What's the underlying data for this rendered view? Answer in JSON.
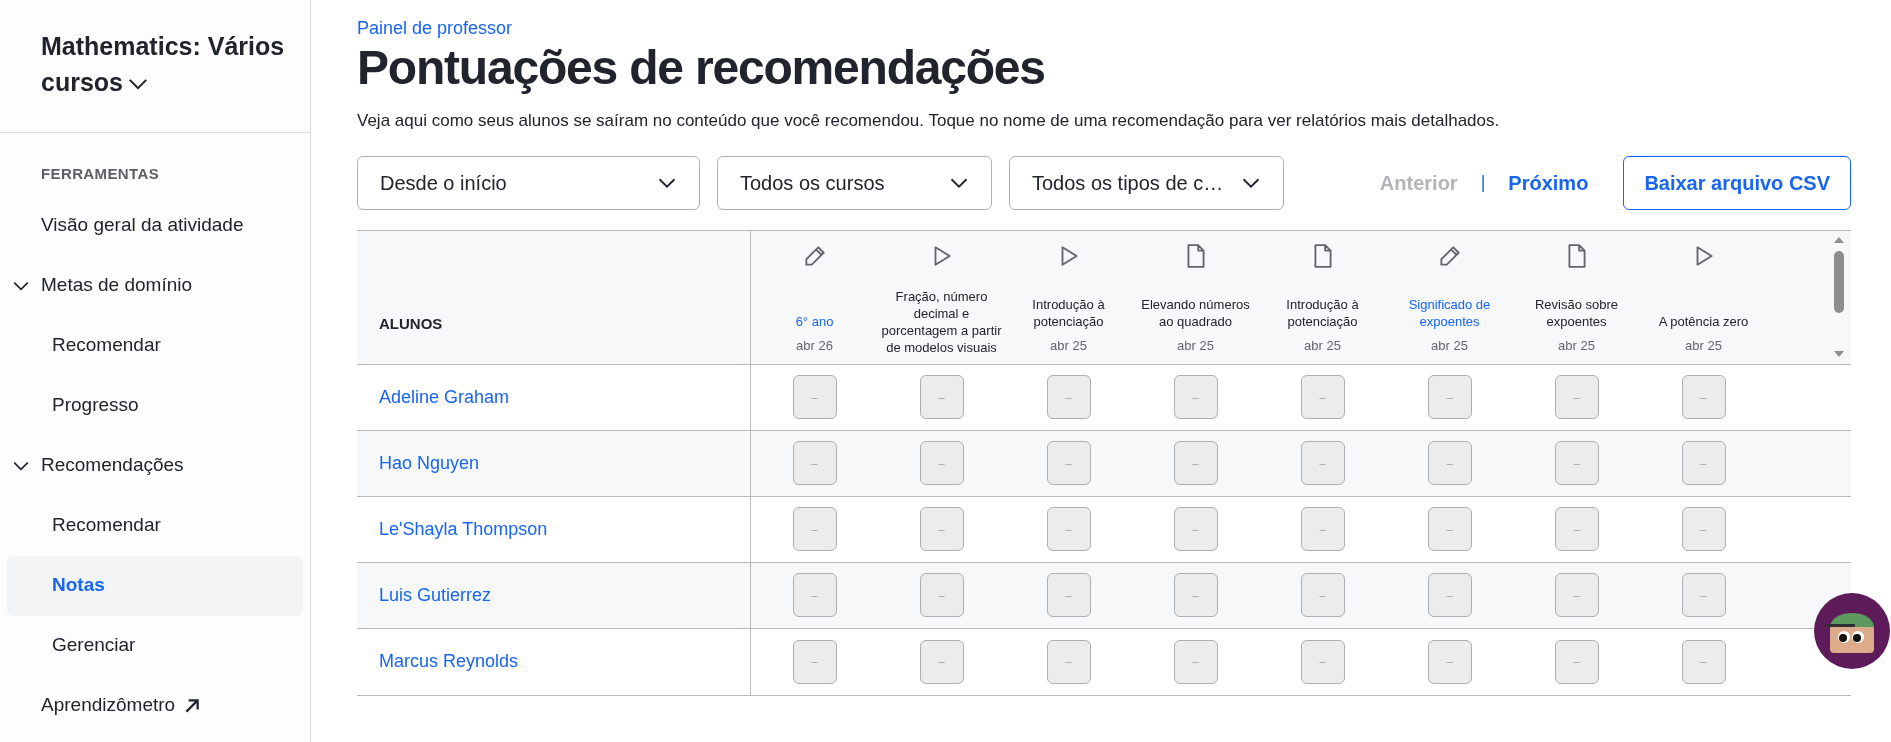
{
  "sidebar": {
    "course_title": "Mathematics: Vários cursos",
    "section_label": "FERRAMENTAS",
    "items": [
      {
        "label": "Visão geral da atividade",
        "selected": false,
        "external": false
      },
      {
        "label": "Metas de domínio",
        "selected": false,
        "external": false,
        "expanded": true,
        "children": [
          {
            "label": "Recomendar",
            "selected": false
          },
          {
            "label": "Progresso",
            "selected": false
          }
        ]
      },
      {
        "label": "Recomendações",
        "selected": false,
        "external": false,
        "expanded": true,
        "children": [
          {
            "label": "Recomendar",
            "selected": false
          },
          {
            "label": "Notas",
            "selected": true
          },
          {
            "label": "Gerenciar",
            "selected": false
          }
        ]
      },
      {
        "label": "Aprendizômetro",
        "selected": false,
        "external": true
      }
    ]
  },
  "header": {
    "breadcrumb": "Painel de professor",
    "title": "Pontuações de recomendações",
    "description": "Veja aqui como seus alunos se saíram no conteúdo que você recomendou. Toque no nome de uma recomendação para ver relatórios mais detalhados."
  },
  "filters": [
    {
      "value": "Desde o início"
    },
    {
      "value": "Todos os cursos"
    },
    {
      "value": "Todos os tipos de c…"
    }
  ],
  "pagination": {
    "previous": {
      "label": "Anterior",
      "disabled": true
    },
    "separator": "|",
    "next": {
      "label": "Próximo",
      "disabled": false
    }
  },
  "download_button": "Baixar arquivo CSV",
  "table": {
    "student_header": "ALUNOS",
    "columns": [
      {
        "kind": "exercise",
        "title": "6° ano",
        "date": "abr 26",
        "linked": true
      },
      {
        "kind": "video",
        "title": "Fração, número decimal e porcentagem a partir de modelos visuais",
        "linked": false
      },
      {
        "kind": "video",
        "title": "Introdução à potenciação",
        "date": "abr 25",
        "linked": false
      },
      {
        "kind": "article",
        "title": "Elevando números ao quadrado",
        "date": "abr 25",
        "linked": false
      },
      {
        "kind": "article",
        "title": "Introdução à potenciação",
        "date": "abr 25",
        "linked": false
      },
      {
        "kind": "exercise",
        "title": "Significado de expoentes",
        "date": "abr 25",
        "linked": true
      },
      {
        "kind": "article",
        "title": "Revisão sobre expoentes",
        "date": "abr 25",
        "linked": false
      },
      {
        "kind": "video",
        "title": "A potência zero",
        "date": "abr 25",
        "linked": false
      }
    ],
    "rows": [
      {
        "student": "Adeline Graham",
        "scores": [
          "–",
          "–",
          "–",
          "–",
          "–",
          "–",
          "–",
          "–"
        ]
      },
      {
        "student": "Hao Nguyen",
        "scores": [
          "–",
          "–",
          "–",
          "–",
          "–",
          "–",
          "–",
          "–"
        ]
      },
      {
        "student": "Le'Shayla Thompson",
        "scores": [
          "–",
          "–",
          "–",
          "–",
          "–",
          "–",
          "–",
          "–"
        ]
      },
      {
        "student": "Luis Gutierrez",
        "scores": [
          "–",
          "–",
          "–",
          "–",
          "–",
          "–",
          "–",
          "–"
        ]
      },
      {
        "student": "Marcus Reynolds",
        "scores": [
          "–",
          "–",
          "–",
          "–",
          "–",
          "–",
          "–",
          "–"
        ]
      }
    ]
  }
}
